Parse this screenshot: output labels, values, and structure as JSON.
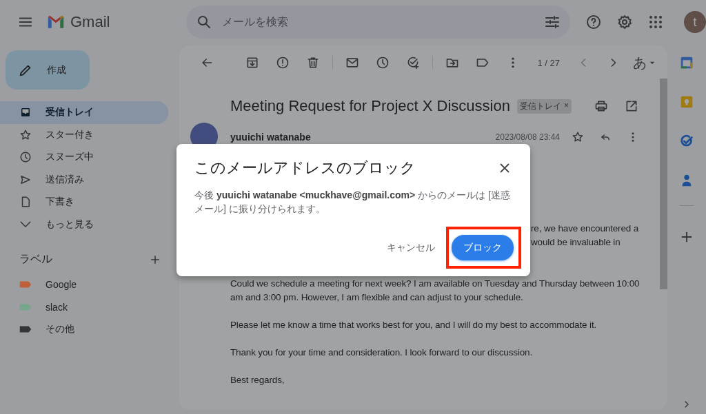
{
  "header": {
    "brand": "Gmail",
    "search": {
      "placeholder": "メールを検索"
    },
    "avatar": "t"
  },
  "compose": {
    "label": "作成"
  },
  "nav": [
    {
      "kind": "inbox",
      "label": "受信トレイ",
      "selected": true
    },
    {
      "kind": "star",
      "label": "スター付き",
      "selected": false
    },
    {
      "kind": "snooze",
      "label": "スヌーズ中",
      "selected": false
    },
    {
      "kind": "sent",
      "label": "送信済み",
      "selected": false
    },
    {
      "kind": "draft",
      "label": "下書き",
      "selected": false
    },
    {
      "kind": "more",
      "label": "もっと見る",
      "selected": false
    }
  ],
  "labels": {
    "heading": "ラベル",
    "items": [
      {
        "name": "Google",
        "color": "#c0603a"
      },
      {
        "name": "slack",
        "color": "#78a68c"
      },
      {
        "name": "その他",
        "color": "#343538"
      }
    ]
  },
  "toolbar": {
    "counter": "1 / 27",
    "input_mode": "あ"
  },
  "message": {
    "subject": "Meeting Request for Project X Discussion",
    "tag": "受信トレイ",
    "tag_remove": "×",
    "sender": "yuuichi watanabe",
    "date": "2023/08/08 23:44",
    "body": [
      {
        "kind": "fragment",
        "lines": [
          "re, we have encountered a",
          "would be invaluable in"
        ]
      },
      {
        "kind": "paragraph",
        "text": "Could we schedule a meeting for next week? I am available on Tuesday and Thursday between 10:00 am and 3:00 pm. However, I am flexible and can adjust to your schedule."
      },
      {
        "kind": "paragraph",
        "text": "Please let me know a time that works best for you, and I will do my best to accommodate it."
      },
      {
        "kind": "paragraph",
        "text": "Thank you for your time and consideration. I look forward to our discussion."
      },
      {
        "kind": "paragraph",
        "text": "Best regards,"
      }
    ]
  },
  "dialog": {
    "title": "このメールアドレスのブロック",
    "message": "今後 **yuuichi watanabe <muckhave@gmail.com>** からのメールは [迷惑メール] に振り分けられます。",
    "cancel": "キャンセル",
    "confirm": "ブロック",
    "highlighted": true
  }
}
